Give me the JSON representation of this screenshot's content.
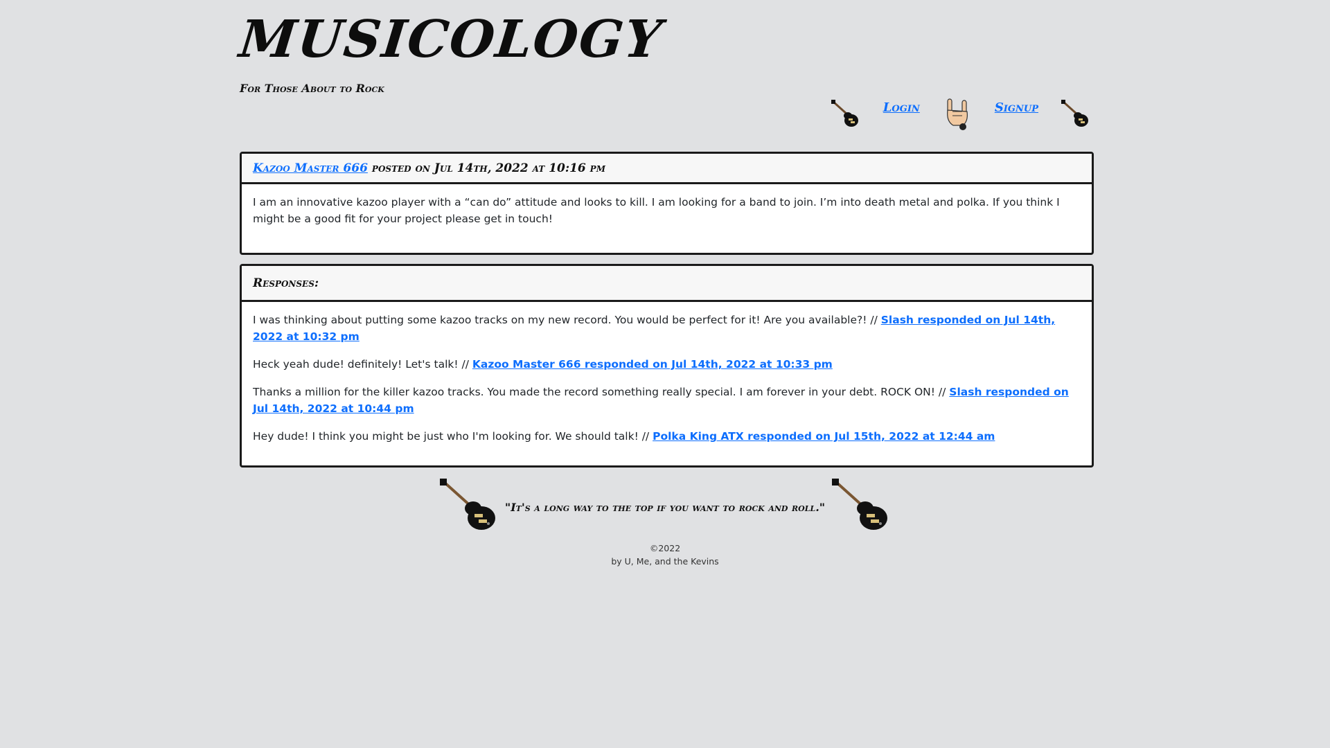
{
  "header": {
    "title": "MUSICOLOGY",
    "tagline": "For Those About to Rock"
  },
  "nav": {
    "login": "Login",
    "signup": "Signup"
  },
  "post": {
    "author": "Kazoo Master 666",
    "meta": "posted on Jul 14th, 2022 at 10:16 pm",
    "body": "I am an innovative kazoo player with a “can do” attitude and looks to kill. I am looking for a band to join. I’m into death metal and polka. If you think I might be a good fit for your project please get in touch!"
  },
  "responses": {
    "heading": "Responses:",
    "items": [
      {
        "text": "I was thinking about putting some kazoo tracks on my new record. You would be perfect for it! Are you available?! //",
        "link": "Slash responded on Jul 14th, 2022 at 10:32 pm"
      },
      {
        "text": "Heck yeah dude! definitely! Let's talk! //",
        "link": "Kazoo Master 666 responded on Jul 14th, 2022 at 10:33 pm"
      },
      {
        "text": "Thanks a million for the killer kazoo tracks. You made the record something really special. I am forever in your debt. ROCK ON! //",
        "link": "Slash responded on Jul 14th, 2022 at 10:44 pm"
      },
      {
        "text": "Hey dude! I think you might be just who I'm looking for. We should talk! //",
        "link": "Polka King ATX responded on Jul 15th, 2022 at 12:44 am"
      }
    ]
  },
  "footer": {
    "quote": "\"It's a long way to the top if you want to rock and roll.\"",
    "copyright": "©2022",
    "credit": "by U, Me, and the Kevins"
  },
  "icons": {
    "guitar": "guitar-icon",
    "rock_hand": "rock-hand-icon"
  },
  "colors": {
    "background": "#e0e1e3",
    "link": "#0d6efd",
    "border": "#1a1a1a"
  }
}
